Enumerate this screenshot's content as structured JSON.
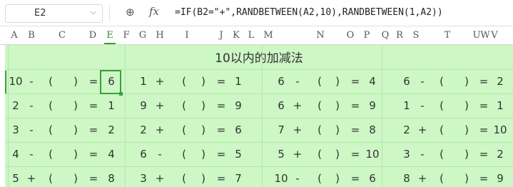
{
  "formula_bar": {
    "name_box": "E2",
    "dropdown_icon": "chevron-down-icon",
    "zoom_icon": "zoom-icon",
    "fx_label": "fx",
    "formula": "=IF(B2=\"+\",RANDBETWEEN(A2,10),RANDBETWEEN(1,A2))"
  },
  "columns": [
    "A",
    "B",
    "C",
    "D",
    "E",
    "F",
    "G",
    "H",
    "I",
    "J",
    "K",
    "L",
    "M",
    "N",
    "O",
    "P",
    "Q",
    "R",
    "S",
    "T",
    "U",
    "V",
    "W"
  ],
  "active_column": "E",
  "sheet": {
    "title": "10以内的加减法",
    "rows": [
      [
        "10",
        "-",
        "(",
        ")",
        "=",
        "6",
        "1",
        "+",
        "(",
        ")",
        "=",
        "1",
        "6",
        "-",
        "(",
        ")",
        "=",
        "4",
        "6",
        "-",
        "(",
        ")",
        "=",
        "2"
      ],
      [
        "2",
        "-",
        "(",
        ")",
        "=",
        "1",
        "9",
        "+",
        "(",
        ")",
        "=",
        "9",
        "6",
        "+",
        "(",
        ")",
        "=",
        "9",
        "1",
        "-",
        "(",
        ")",
        "=",
        "1"
      ],
      [
        "3",
        "-",
        "(",
        ")",
        "=",
        "2",
        "2",
        "+",
        "(",
        ")",
        "=",
        "6",
        "7",
        "+",
        "(",
        ")",
        "=",
        "8",
        "2",
        "+",
        "(",
        ")",
        "=",
        "10"
      ],
      [
        "4",
        "-",
        "(",
        ")",
        "=",
        "4",
        "6",
        "-",
        "(",
        ")",
        "=",
        "5",
        "5",
        "+",
        "(",
        ")",
        "=",
        "10",
        "3",
        "-",
        "(",
        ")",
        "=",
        "2"
      ],
      [
        "5",
        "+",
        "(",
        ")",
        "=",
        "8",
        "3",
        "+",
        "(",
        ")",
        "=",
        "7",
        "10",
        "-",
        "(",
        ")",
        "=",
        "6",
        "8",
        "+",
        "(",
        ")",
        "=",
        "9"
      ]
    ]
  },
  "colors": {
    "sheet_bg": "#cdf7c5",
    "selection": "#3aa13a"
  }
}
